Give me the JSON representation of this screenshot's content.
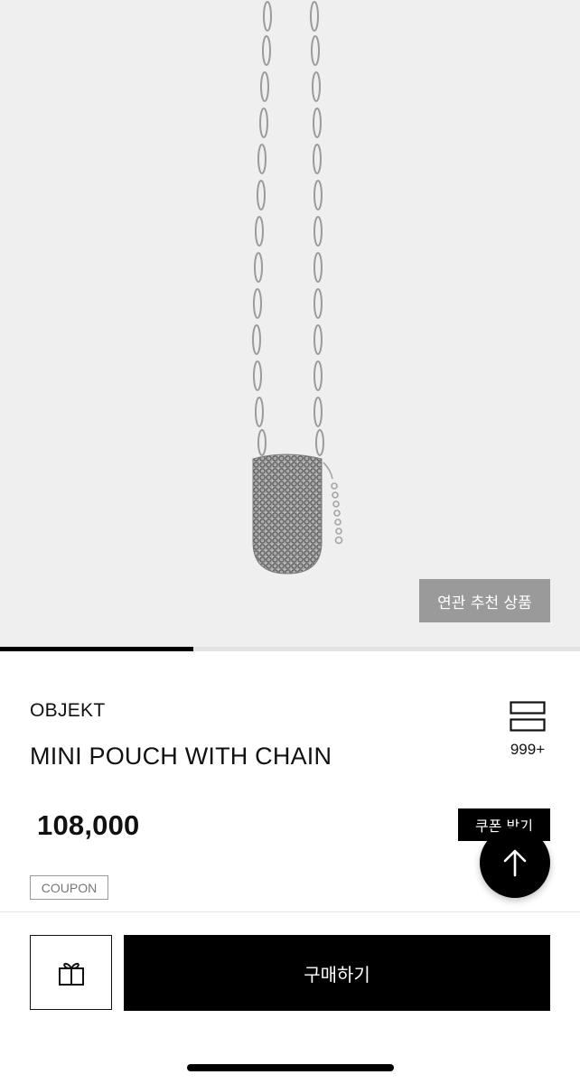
{
  "hero": {
    "image_description_icon": "necklace-pouch-image",
    "related_button_label": "연관 추천 상품",
    "carousel_progress": 0.333
  },
  "product": {
    "brand": "OBJEKT",
    "title": "MINI POUCH WITH CHAIN",
    "price": "108,000",
    "coupon_badge": "COUPON",
    "wish_count": "999+"
  },
  "actions": {
    "coupon_download_label": "쿠폰 받기",
    "buy_label": "구매하기",
    "gift_icon": "gift-icon",
    "scroll_top_icon": "arrow-up-icon"
  },
  "colors": {
    "accent": "#000000",
    "hero_bg": "#efefef",
    "related_btn_bg": "#9a9a9a"
  }
}
